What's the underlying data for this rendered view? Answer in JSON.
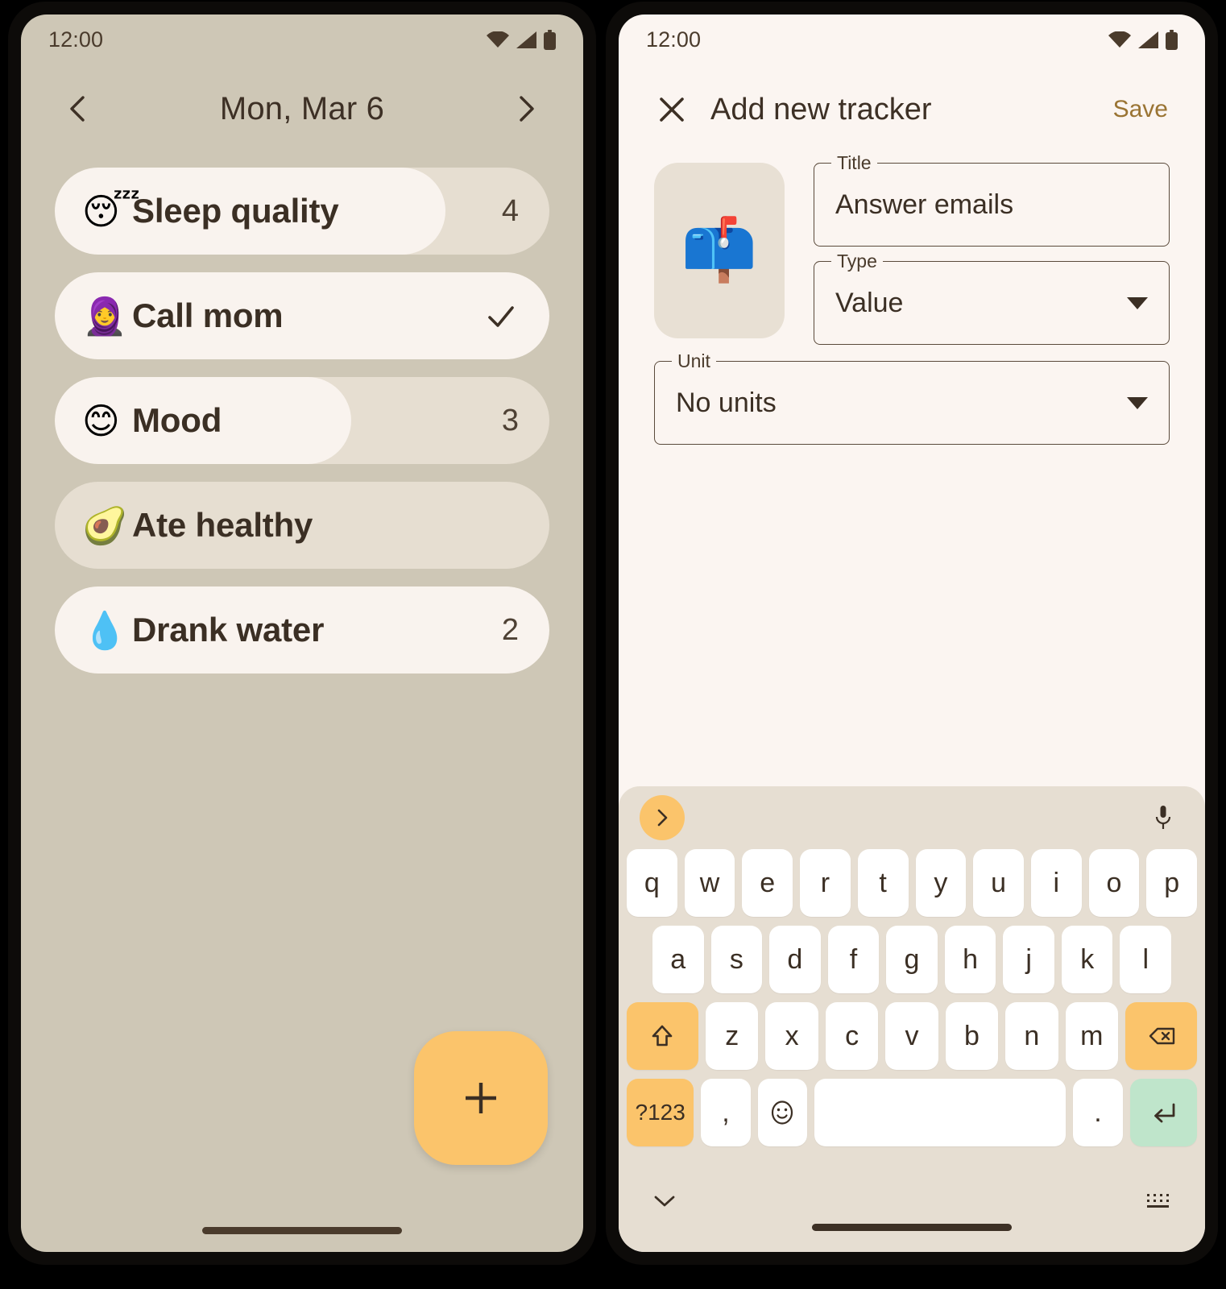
{
  "left_phone": {
    "status_bar": {
      "time": "12:00",
      "icons": [
        "wifi-icon",
        "cellular-icon",
        "battery-icon"
      ]
    },
    "date_header": {
      "prev_label": "chevron-left-icon",
      "title": "Mon, Mar 6",
      "next_label": "chevron-right-icon"
    },
    "trackers": [
      {
        "emoji": "😴",
        "emoji_name": "sleeping-face-emoji",
        "label": "Sleep quality",
        "value": "4",
        "type": "value",
        "fill_percent": 79
      },
      {
        "emoji": "🧕",
        "emoji_name": "woman-with-headscarf-emoji",
        "label": "Call mom",
        "value": "✓",
        "type": "check",
        "fill_percent": 100
      },
      {
        "emoji": "😊",
        "emoji_name": "smiling-face-emoji",
        "label": "Mood",
        "value": "3",
        "type": "value",
        "fill_percent": 60
      },
      {
        "emoji": "🥑",
        "emoji_name": "avocado-emoji",
        "label": "Ate healthy",
        "value": "",
        "type": "empty",
        "fill_percent": 0
      },
      {
        "emoji": "💧",
        "emoji_name": "droplet-emoji",
        "label": "Drank water",
        "value": "2",
        "type": "value",
        "fill_percent": 100
      }
    ],
    "fab": {
      "label": "+",
      "icon": "plus-icon"
    }
  },
  "right_phone": {
    "status_bar": {
      "time": "12:00",
      "icons": [
        "wifi-icon",
        "cellular-icon",
        "battery-icon"
      ]
    },
    "appbar": {
      "close_icon": "close-icon",
      "title": "Add new tracker",
      "save_label": "Save"
    },
    "form": {
      "emoji": "📫",
      "emoji_name": "mailbox-emoji",
      "fields": [
        {
          "label": "Title",
          "value": "Answer emails",
          "kind": "text"
        },
        {
          "label": "Type",
          "value": "Value",
          "kind": "select"
        },
        {
          "label": "Unit",
          "value": "No units",
          "kind": "select"
        }
      ]
    },
    "keyboard": {
      "suggestion_bar": {
        "expand_icon": "chevron-right-icon",
        "mic_icon": "microphone-icon"
      },
      "row1": [
        "q",
        "w",
        "e",
        "r",
        "t",
        "y",
        "u",
        "i",
        "o",
        "p"
      ],
      "row2": [
        "a",
        "s",
        "d",
        "f",
        "g",
        "h",
        "j",
        "k",
        "l"
      ],
      "row3_shift": "shift-icon",
      "row3": [
        "z",
        "x",
        "c",
        "v",
        "b",
        "n",
        "m"
      ],
      "row3_backspace": "backspace-icon",
      "row4_symbols": "?123",
      "row4_comma": ",",
      "row4_emoji": "emoji-icon",
      "row4_space": "",
      "row4_period": ".",
      "row4_enter": "enter-icon",
      "bottom": {
        "hide_icon": "chevron-down-icon",
        "switch_icon": "keyboard-switch-icon"
      }
    }
  },
  "colors": {
    "left_background": "#cec7b6",
    "tracker_track": "#e6ded1",
    "tracker_fill": "#f9f3ee",
    "accent_orange": "#fbc46b",
    "enter_green": "#bfe5cb",
    "right_background": "#fbf5f1",
    "keyboard_background": "#e6ded2",
    "text_dark": "#3b2f24",
    "save_gold": "#9a7433"
  }
}
